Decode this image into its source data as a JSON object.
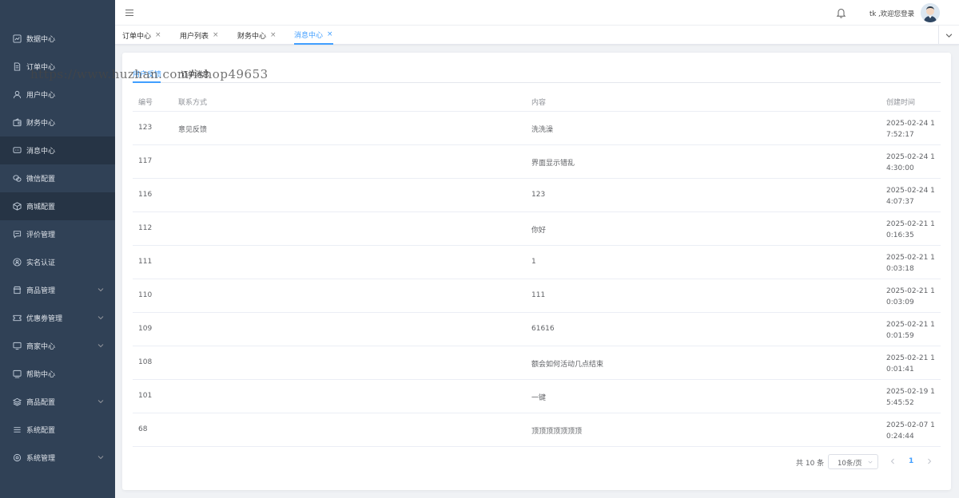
{
  "sidebar": {
    "items": [
      {
        "label": "数据中心",
        "icon": "chart-icon"
      },
      {
        "label": "订单中心",
        "icon": "document-icon"
      },
      {
        "label": "用户中心",
        "icon": "user-icon"
      },
      {
        "label": "财务中心",
        "icon": "wallet-icon"
      },
      {
        "label": "消息中心",
        "icon": "message-icon"
      },
      {
        "label": "微信配置",
        "icon": "wechat-icon"
      },
      {
        "label": "商城配置",
        "icon": "box-icon"
      },
      {
        "label": "评价管理",
        "icon": "comment-icon"
      },
      {
        "label": "实名认证",
        "icon": "id-icon"
      },
      {
        "label": "商品管理",
        "icon": "shop-icon"
      },
      {
        "label": "优惠劵管理",
        "icon": "coupon-icon"
      },
      {
        "label": "商家中心",
        "icon": "monitor-icon"
      },
      {
        "label": "帮助中心",
        "icon": "help-icon"
      },
      {
        "label": "商品配置",
        "icon": "layers-icon"
      },
      {
        "label": "系统配置",
        "icon": "list-icon"
      },
      {
        "label": "系统管理",
        "icon": "gear-icon"
      }
    ]
  },
  "header": {
    "welcome": "tk ,欢迎您登录"
  },
  "tabs": [
    {
      "label": "订单中心",
      "close": "×"
    },
    {
      "label": "用户列表",
      "close": "×"
    },
    {
      "label": "财务中心",
      "close": "×"
    },
    {
      "label": "消息中心",
      "close": "×"
    }
  ],
  "subtabs": [
    "用户反馈",
    "订单消息"
  ],
  "watermark": "https://www.huzhan.com/ishop49653",
  "table": {
    "headers": [
      "编号",
      "联系方式",
      "内容",
      "创建时间"
    ],
    "rows": [
      {
        "id": "123",
        "contact": "意见反馈",
        "content": "洗洗澡",
        "time": "2025-02-24 17:52:17"
      },
      {
        "id": "117",
        "contact": "",
        "content": "界面显示错乱",
        "time": "2025-02-24 14:30:00"
      },
      {
        "id": "116",
        "contact": "",
        "content": "123",
        "time": "2025-02-24 14:07:37"
      },
      {
        "id": "112",
        "contact": "",
        "content": "你好",
        "time": "2025-02-21 10:16:35"
      },
      {
        "id": "111",
        "contact": "",
        "content": "1",
        "time": "2025-02-21 10:03:18"
      },
      {
        "id": "110",
        "contact": "",
        "content": "111",
        "time": "2025-02-21 10:03:09"
      },
      {
        "id": "109",
        "contact": "",
        "content": "61616",
        "time": "2025-02-21 10:01:59"
      },
      {
        "id": "108",
        "contact": "",
        "content": "额会如何活动几点结束",
        "time": "2025-02-21 10:01:41"
      },
      {
        "id": "101",
        "contact": "",
        "content": "一键",
        "time": "2025-02-19 15:45:52"
      },
      {
        "id": "68",
        "contact": "",
        "content": "顶顶顶顶顶顶顶",
        "time": "2025-02-07 10:24:44"
      }
    ]
  },
  "pagination": {
    "total": "共 10 条",
    "page_size": "10条/页",
    "current_page": "1"
  },
  "colors": {
    "sidebar_bg": "#304156",
    "accent": "#409eff"
  }
}
